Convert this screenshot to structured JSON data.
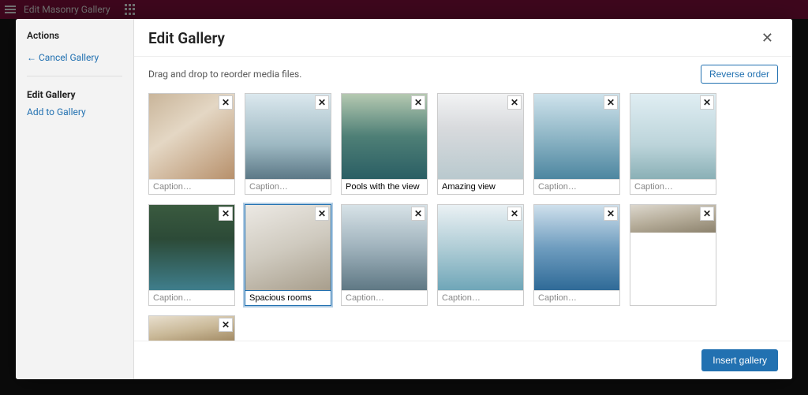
{
  "topbar": {
    "title": "Edit Masonry Gallery"
  },
  "sidebar": {
    "actions_heading": "Actions",
    "cancel_label": "Cancel Gallery",
    "edit_heading": "Edit Gallery",
    "add_label": "Add to Gallery"
  },
  "main": {
    "title": "Edit Gallery",
    "instruction": "Drag and drop to reorder media files.",
    "reverse_label": "Reverse order",
    "insert_label": "Insert gallery",
    "caption_placeholder": "Caption…",
    "items": [
      {
        "caption": "",
        "img": "img-1",
        "selected": false,
        "half": false
      },
      {
        "caption": "",
        "img": "img-2",
        "selected": false,
        "half": false
      },
      {
        "caption": "Pools with the view",
        "img": "img-3",
        "selected": false,
        "half": false
      },
      {
        "caption": "Amazing view",
        "img": "img-4",
        "selected": false,
        "half": false
      },
      {
        "caption": "",
        "img": "img-5",
        "selected": false,
        "half": false
      },
      {
        "caption": "",
        "img": "img-6",
        "selected": false,
        "half": false
      },
      {
        "caption": "",
        "img": "img-7",
        "selected": false,
        "half": false
      },
      {
        "caption": "Spacious rooms",
        "img": "img-8",
        "selected": true,
        "half": false
      },
      {
        "caption": "",
        "img": "img-9",
        "selected": false,
        "half": false
      },
      {
        "caption": "",
        "img": "img-10",
        "selected": false,
        "half": false
      },
      {
        "caption": "",
        "img": "img-11",
        "selected": false,
        "half": false
      },
      {
        "caption": "",
        "img": "img-12",
        "selected": false,
        "half": true
      },
      {
        "caption": "",
        "img": "img-13",
        "selected": false,
        "half": true
      }
    ]
  }
}
